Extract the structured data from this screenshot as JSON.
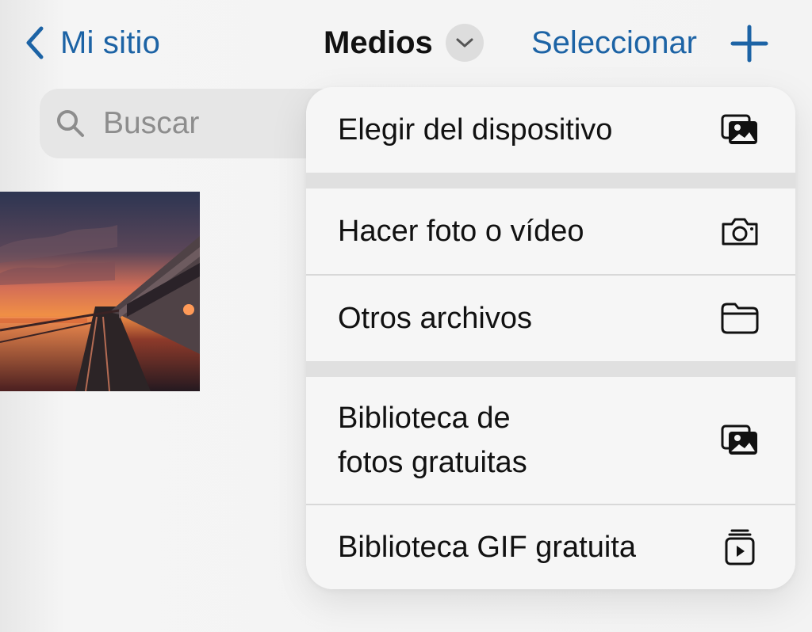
{
  "header": {
    "back_label": "Mi sitio",
    "title": "Medios",
    "select_label": "Seleccionar"
  },
  "search": {
    "placeholder": "Buscar"
  },
  "menu": {
    "items": [
      {
        "label": "Elegir del dispositivo",
        "icon": "photos-stack-icon"
      },
      {
        "label": "Hacer foto o vídeo",
        "icon": "camera-icon"
      },
      {
        "label": "Otros archivos",
        "icon": "folder-icon"
      },
      {
        "label_line1": "Biblioteca de",
        "label_line2": "fotos gratuitas",
        "icon": "photos-stack-icon"
      },
      {
        "label": "Biblioteca GIF gratuita",
        "icon": "gif-library-icon"
      }
    ]
  },
  "colors": {
    "accent": "#1c63a5",
    "background": "#f3f3f3",
    "menu_background": "#f6f6f6",
    "separator": "#e0e0e0"
  }
}
